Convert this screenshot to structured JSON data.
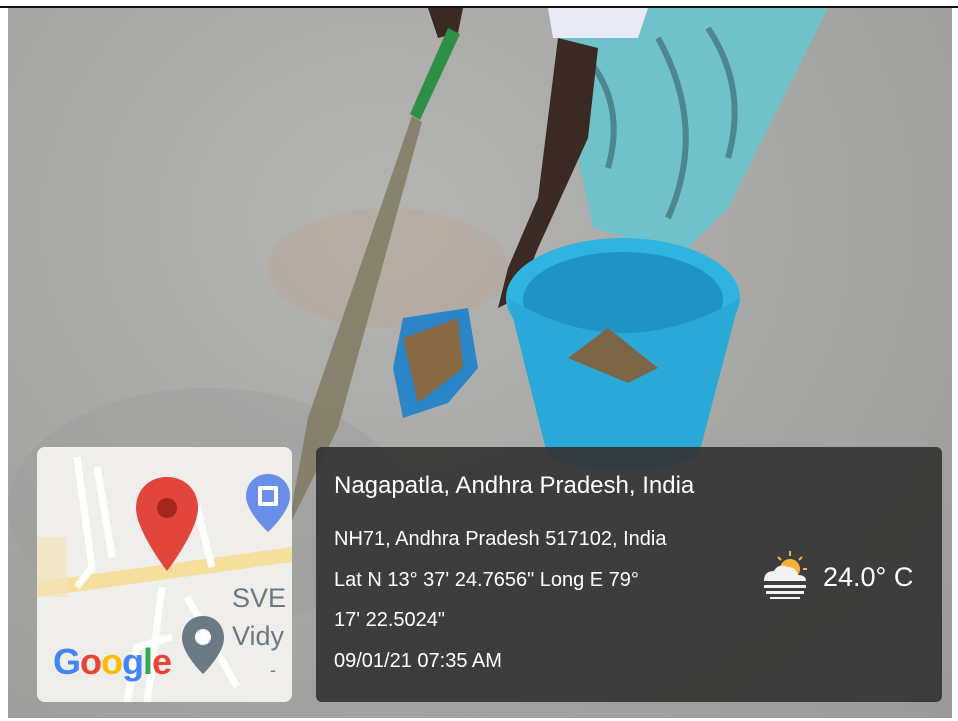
{
  "photo": {
    "subject": "photo"
  },
  "map": {
    "labels": [
      "SVE",
      "Vidy",
      "-"
    ],
    "google_logo": [
      "G",
      "o",
      "o",
      "g",
      "l",
      "e"
    ],
    "google_colors": [
      "#4285F4",
      "#EA4335",
      "#FBBC05",
      "#4285F4",
      "#34A853",
      "#EA4335"
    ],
    "pin_icon": "map-pin-icon",
    "pin_color": "#e2453c",
    "poi_icon": "school-poi-icon",
    "poi_color": "#6b8ee8"
  },
  "info": {
    "place": "Nagapatla, Andhra Pradesh, India",
    "address": "NH71, Andhra Pradesh 517102, India",
    "lat_line1": "Lat N 13° 37' 24.7656\" Long E 79°",
    "lat_line2": "17' 22.5024\"",
    "datetime": "09/01/21 07:35 AM",
    "weather_icon": "partly-cloudy-sun-icon",
    "temperature": "24.0° C"
  }
}
